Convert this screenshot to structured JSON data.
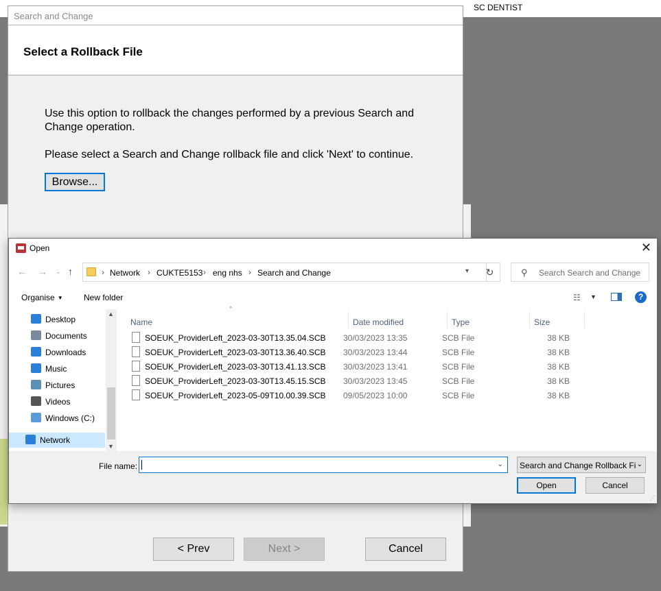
{
  "background_app": {
    "top_label": "SC DENTIST"
  },
  "wizard": {
    "window_title": "Search and Change",
    "header": "Select a Rollback File",
    "para1": "Use this option to rollback the changes performed by a previous Search and Change operation.",
    "para2": "Please select a Search and Change rollback file and click 'Next' to continue.",
    "browse_label": "Browse...",
    "prev_label": "< Prev",
    "next_label": "Next >",
    "cancel_label": "Cancel"
  },
  "dialog": {
    "title": "Open",
    "close_glyph": "✕",
    "breadcrumb": [
      "Network",
      "CUKTE5153",
      "eng nhs",
      "Search and Change"
    ],
    "search_placeholder": "Search Search and Change",
    "toolbar": {
      "organise": "Organise",
      "new_folder": "New folder"
    },
    "nav_items": [
      {
        "label": "Desktop",
        "icon": "desktop-icon",
        "color": "#2a7fd6"
      },
      {
        "label": "Documents",
        "icon": "documents-icon",
        "color": "#7a8a9a"
      },
      {
        "label": "Downloads",
        "icon": "downloads-icon",
        "color": "#2a7fd6"
      },
      {
        "label": "Music",
        "icon": "music-icon",
        "color": "#2a7fd6"
      },
      {
        "label": "Pictures",
        "icon": "pictures-icon",
        "color": "#5b8fb5"
      },
      {
        "label": "Videos",
        "icon": "videos-icon",
        "color": "#555555"
      },
      {
        "label": "Windows (C:)",
        "icon": "drive-icon",
        "color": "#5a9bd8"
      },
      {
        "label": "Network",
        "icon": "network-icon",
        "color": "#2a7fd6",
        "selected": true
      }
    ],
    "columns": {
      "name": "Name",
      "date": "Date modified",
      "type": "Type",
      "size": "Size"
    },
    "files": [
      {
        "name": "SOEUK_ProviderLeft_2023-03-30T13.35.04.SCB",
        "date": "30/03/2023 13:35",
        "type": "SCB File",
        "size": "38 KB"
      },
      {
        "name": "SOEUK_ProviderLeft_2023-03-30T13.36.40.SCB",
        "date": "30/03/2023 13:44",
        "type": "SCB File",
        "size": "38 KB"
      },
      {
        "name": "SOEUK_ProviderLeft_2023-03-30T13.41.13.SCB",
        "date": "30/03/2023 13:41",
        "type": "SCB File",
        "size": "38 KB"
      },
      {
        "name": "SOEUK_ProviderLeft_2023-03-30T13.45.15.SCB",
        "date": "30/03/2023 13:45",
        "type": "SCB File",
        "size": "38 KB"
      },
      {
        "name": "SOEUK_ProviderLeft_2023-05-09T10.00.39.SCB",
        "date": "09/05/2023 10:00",
        "type": "SCB File",
        "size": "38 KB"
      }
    ],
    "file_name_label": "File name:",
    "file_name_value": "",
    "file_type": "Search and Change Rollback Fil",
    "open_label": "Open",
    "cancel_label": "Cancel"
  }
}
